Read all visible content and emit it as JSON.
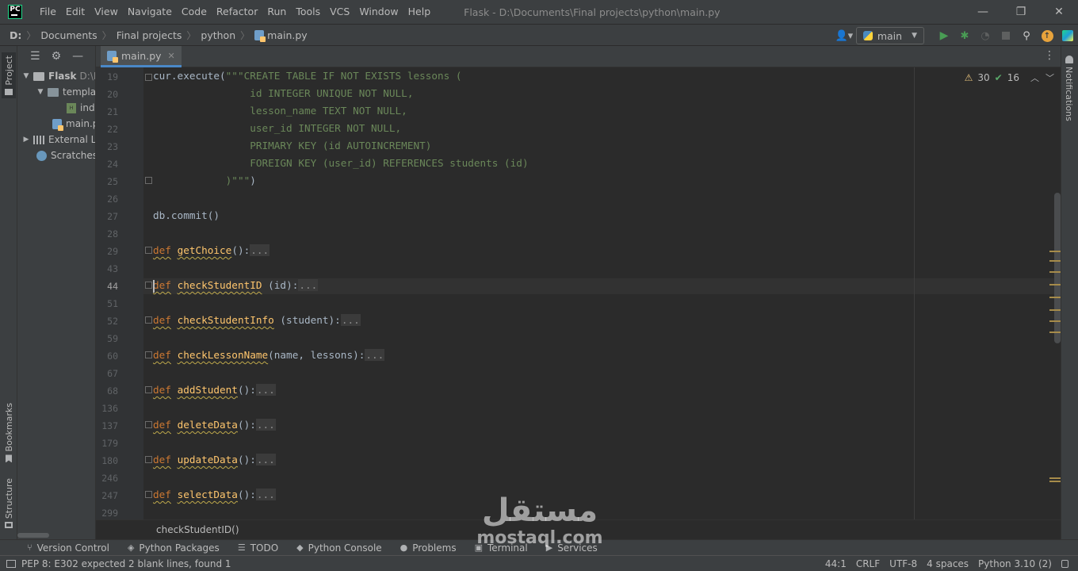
{
  "app": {
    "logo_text": "PC"
  },
  "menubar": {
    "items": [
      "File",
      "Edit",
      "View",
      "Navigate",
      "Code",
      "Refactor",
      "Run",
      "Tools",
      "VCS",
      "Window",
      "Help"
    ],
    "window_title": "Flask - D:\\Documents\\Final projects\\python\\main.py"
  },
  "window_controls": {
    "minimize": "—",
    "restore": "❐",
    "close": "✕"
  },
  "navbar": {
    "breadcrumbs": [
      "D:",
      "Documents",
      "Final projects",
      "python",
      "main.py"
    ],
    "run_config": "main"
  },
  "left_stripe": {
    "project": "Project",
    "bookmarks": "Bookmarks",
    "structure": "Structure"
  },
  "project_tree": {
    "rows": [
      {
        "label": "Flask",
        "suffix": "D:\\D"
      },
      {
        "label": "templa"
      },
      {
        "label": "inde"
      },
      {
        "label": "main.p"
      },
      {
        "label": "External Li"
      },
      {
        "label": "Scratches a"
      }
    ]
  },
  "editor": {
    "tab_label": "main.py",
    "warnings": "30",
    "weak_warnings": "16",
    "footer_breadcrumb": "checkStudentID()",
    "line_numbers": [
      "19",
      "20",
      "21",
      "22",
      "23",
      "24",
      "25",
      "26",
      "27",
      "28",
      "29",
      "43",
      "44",
      "51",
      "52",
      "59",
      "60",
      "67",
      "68",
      "136",
      "137",
      "179",
      "180",
      "246",
      "247",
      "299"
    ],
    "current_line": "44",
    "code": {
      "l19a": "cur.execute(",
      "l19b": "\"\"\"CREATE TABLE IF NOT EXISTS lessons (",
      "l20": "                id INTEGER UNIQUE NOT NULL,",
      "l21": "                lesson_name TEXT NOT NULL,",
      "l22": "                user_id INTEGER NOT NULL,",
      "l23": "                PRIMARY KEY (id AUTOINCREMENT)",
      "l24": "                FOREIGN KEY (user_id) REFERENCES students (id)",
      "l25a": "            )\"\"\"",
      "l25b": ")",
      "l27": "db.commit()",
      "def_kw": "def",
      "fold_dots": "...",
      "f1_name": "getChoice",
      "f1_args": "():",
      "f2_name": "checkStudentID",
      "f2_args": " (id):",
      "f3_name": "checkStudentInfo",
      "f3_args": " (student):",
      "f4_name": "checkLessonName",
      "f4_args": "(name, lessons):",
      "f5_name": "addStudent",
      "f5_args": "():",
      "f6_name": "deleteData",
      "f6_args": "():",
      "f7_name": "updateData",
      "f7_args": "():",
      "f8_name": "selectData",
      "f8_args": "():"
    }
  },
  "right_stripe": {
    "notifications": "Notifications"
  },
  "tool_tabs": [
    {
      "icon": "version-control-icon",
      "label": "Version Control"
    },
    {
      "icon": "python-packages-icon",
      "label": "Python Packages"
    },
    {
      "icon": "todo-icon",
      "label": "TODO"
    },
    {
      "icon": "python-console-icon",
      "label": "Python Console"
    },
    {
      "icon": "problems-icon",
      "label": "Problems"
    },
    {
      "icon": "terminal-icon",
      "label": "Terminal"
    },
    {
      "icon": "services-icon",
      "label": "Services"
    }
  ],
  "status_bar": {
    "message": "PEP 8: E302 expected 2 blank lines, found 1",
    "position": "44:1",
    "line_sep": "CRLF",
    "encoding": "UTF-8",
    "indent": "4 spaces",
    "interpreter": "Python 3.10 (2)"
  },
  "watermark": {
    "logo": "مستقل",
    "text": "mostaql.com"
  },
  "colors": {
    "keyword": "#cc7832",
    "function": "#ffc66d",
    "string": "#6a8759",
    "accent": "#4a88c7"
  }
}
